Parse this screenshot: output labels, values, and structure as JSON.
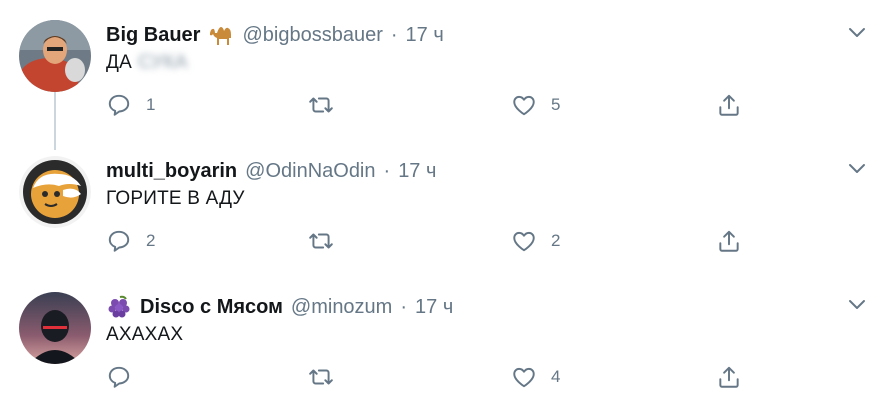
{
  "colors": {
    "text": "#14171a",
    "muted": "#657786",
    "thread_line": "#ccd6dd"
  },
  "tweets": [
    {
      "name": "Big Bauer",
      "name_emoji": "camel-emoji",
      "handle": "@bigbossbauer",
      "time": "17 ч",
      "text": "ДА",
      "text_blurred": "СУКА",
      "counts": {
        "reply": "1",
        "retweet": "",
        "like": "5"
      }
    },
    {
      "name": "multi_boyarin",
      "handle": "@OdinNaOdin",
      "time": "17 ч",
      "text": "ГОРИТЕ В АДУ",
      "counts": {
        "reply": "2",
        "retweet": "",
        "like": "2"
      }
    },
    {
      "name": "Disco с Мясом",
      "name_emoji": "grapes-emoji",
      "handle": "@minozum",
      "time": "17 ч",
      "text": "АХАХАХ",
      "counts": {
        "reply": "",
        "retweet": "",
        "like": "4"
      }
    }
  ],
  "separator": "·"
}
